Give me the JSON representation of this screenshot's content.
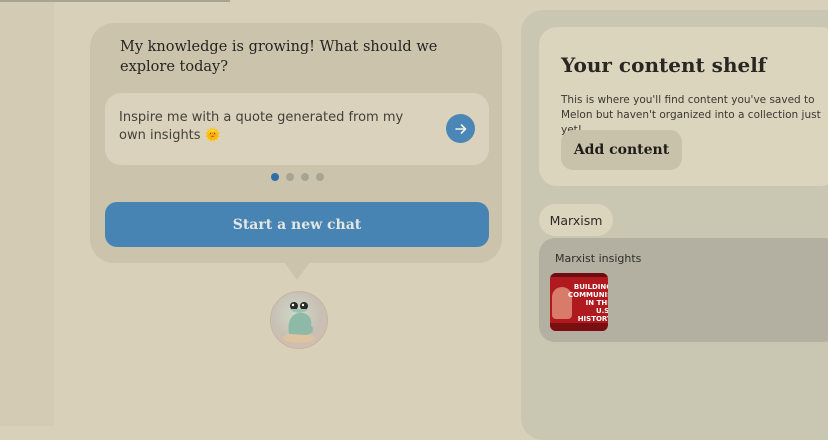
{
  "chat": {
    "prompt": "My knowledge is growing! What should we explore today?",
    "suggestion": "Inspire me with a quote generated from my own insights 🌞",
    "dots_count": 4,
    "active_dot": 1,
    "start_button": "Start a new chat"
  },
  "icons": {
    "send": "arrow-right-icon",
    "avatar": "frog-avatar-icon"
  },
  "shelf": {
    "title": "Your content shelf",
    "description": "This is where you'll find content you've saved to Melon but haven't organized into a collection just yet!",
    "add_button": "Add content"
  },
  "tag": {
    "label": "Marxism"
  },
  "collection": {
    "title": "Marxist insights",
    "thumbnail_text": "BUILDING COMMUNISM IN THE U.S. HISTORY LESSON"
  },
  "colors": {
    "accent": "#4784b4",
    "background": "#d8d0b9",
    "panel": "#c9c6b1",
    "active_dot": "#2e6fa8"
  }
}
